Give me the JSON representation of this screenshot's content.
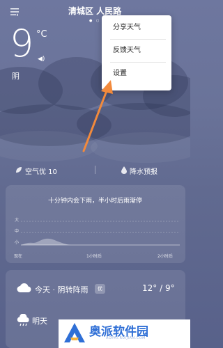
{
  "header": {
    "city": "清城区 人民路"
  },
  "current": {
    "temperature": "9",
    "unit": "°C",
    "condition": "阴"
  },
  "menu": {
    "items": [
      "分享天气",
      "反馈天气",
      "设置"
    ]
  },
  "info_bar": {
    "air_quality": "空气优 10",
    "rain_forecast": "降水预报"
  },
  "rain_card": {
    "summary": "十分钟内会下雨，半小时后雨渐停",
    "levels": [
      "大",
      "中",
      "小"
    ],
    "ticks": [
      "现在",
      "1小时后",
      "2小时后"
    ]
  },
  "forecast": {
    "today": {
      "label": "今天 · 阴转阵雨",
      "badge": "优",
      "high": "12°",
      "low": "9°",
      "separator": "/"
    },
    "tomorrow": {
      "label": "明天"
    }
  },
  "watermark": {
    "brand": "奥派软件园",
    "url": "AOPAI.RUIJIAN.COM"
  },
  "colors": {
    "background": "#6a7399",
    "arrow": "#f28a3c",
    "popup": "#ffffff",
    "brand": "#2f6fd6"
  }
}
